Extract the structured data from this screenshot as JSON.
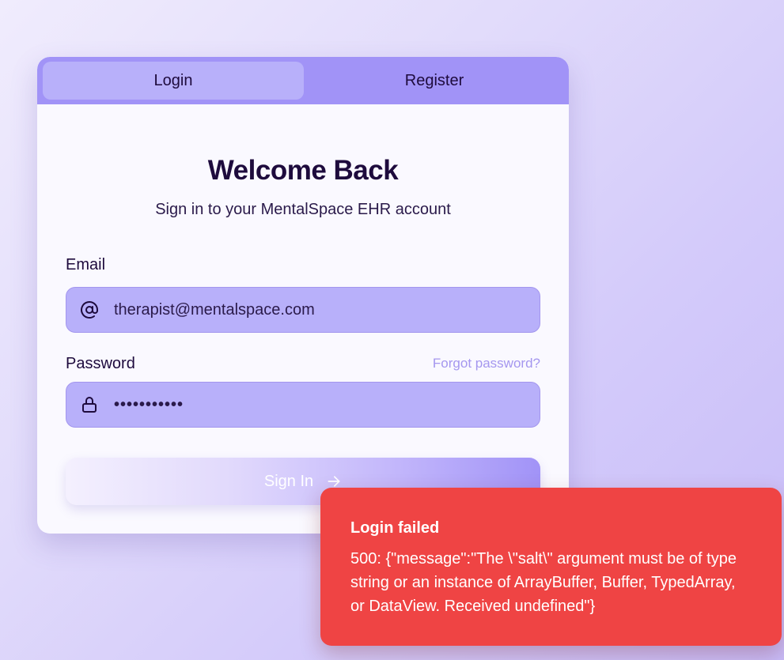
{
  "tabs": [
    {
      "label": "Login",
      "active": true
    },
    {
      "label": "Register",
      "active": false
    }
  ],
  "header": {
    "title": "Welcome Back",
    "subtitle": "Sign in to your MentalSpace EHR account"
  },
  "form": {
    "email": {
      "label": "Email",
      "value": "therapist@mentalspace.com",
      "icon": "at-sign-icon"
    },
    "password": {
      "label": "Password",
      "value": "•••••••••••",
      "icon": "lock-icon",
      "forgot_label": "Forgot password?"
    },
    "submit": {
      "label": "Sign In",
      "icon": "arrow-right-icon"
    }
  },
  "toast": {
    "title": "Login failed",
    "message": "500: {\"message\":\"The \\\"salt\\\" argument must be of type string or an instance of ArrayBuffer, Buffer, TypedArray, or DataView. Received undefined\"}"
  },
  "colors": {
    "accent": "#a193f7",
    "field_background": "#b8b0fa",
    "error": "#ef4444",
    "text_dark": "#1e0b3d",
    "link": "#a597ef"
  }
}
